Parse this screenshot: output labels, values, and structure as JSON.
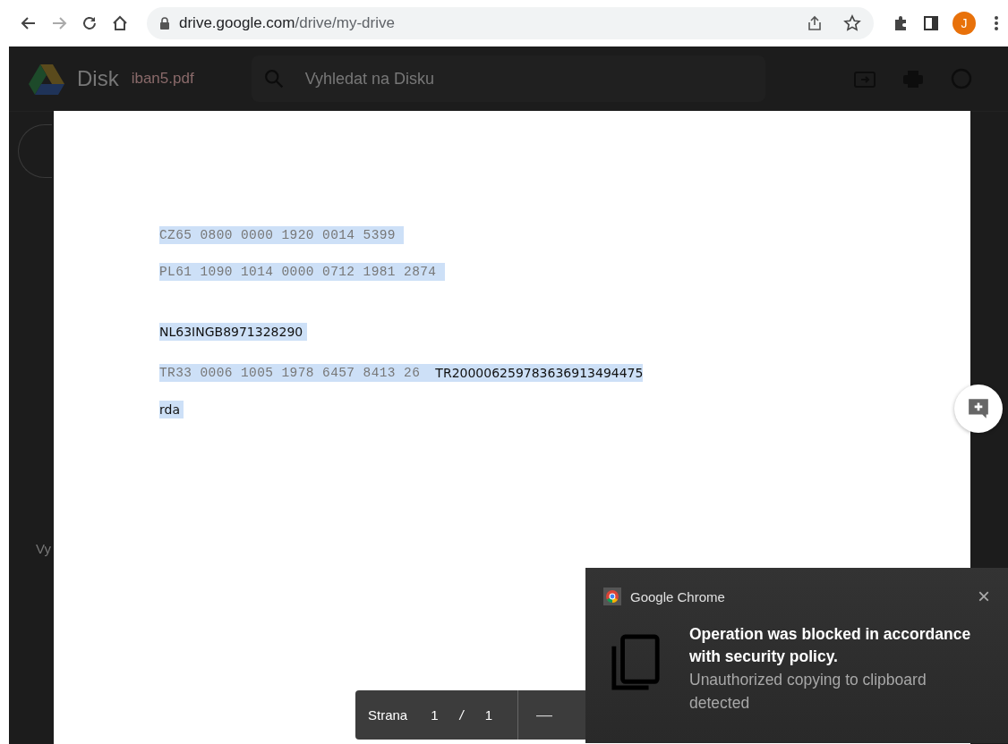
{
  "browser": {
    "url_host": "drive.google.com",
    "url_path": "/drive/my-drive",
    "profile_initial": "J"
  },
  "drive": {
    "app_name": "Disk",
    "file_name": "iban5.pdf",
    "search_placeholder": "Vyhledat na Disku",
    "sidebar_text": "Vy"
  },
  "document": {
    "lines": [
      {
        "segments": [
          {
            "text": "CZ65 0800 0000 1920 0014 5399 ",
            "kind": "mono"
          }
        ]
      },
      {
        "segments": [
          {
            "text": "PL61 1090 1014 0000 0712 1981 2874 ",
            "kind": "mono"
          }
        ]
      },
      {
        "segments": [
          {
            "text": "NL63INGB8971328290 ",
            "kind": "sans"
          }
        ]
      },
      {
        "segments": [
          {
            "text": "TR33 0006 1005 1978 6457 8413 26 ",
            "kind": "mono"
          },
          {
            "text": "TR200006259783636913494475",
            "kind": "sans"
          }
        ]
      },
      {
        "segments": [
          {
            "text": "rda ",
            "kind": "sans"
          }
        ]
      }
    ]
  },
  "page_bar": {
    "label": "Strana",
    "current": "1",
    "separator": "/",
    "total": "1",
    "zoom_out": "—"
  },
  "notification": {
    "app": "Google Chrome",
    "close": "×",
    "title": "Operation was blocked in accordance with security policy.",
    "body": "Unauthorized copying to clipboard detected"
  }
}
